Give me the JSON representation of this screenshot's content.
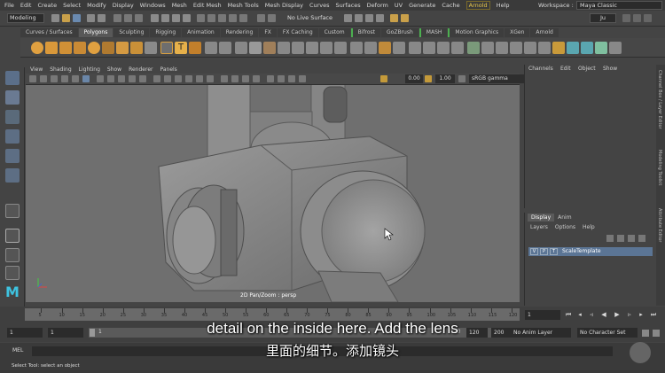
{
  "menubar": {
    "items": [
      "File",
      "Edit",
      "Create",
      "Select",
      "Modify",
      "Display",
      "Windows",
      "Mesh",
      "Edit Mesh",
      "Mesh Tools",
      "Mesh Display",
      "Curves",
      "Surfaces",
      "Deform",
      "UV",
      "Generate",
      "Cache",
      "Arnold",
      "Help"
    ],
    "workspace_label": "Workspace :",
    "workspace_value": "Maya Classic"
  },
  "statusline": {
    "mode": "Modeling",
    "live_surface": "No Live Surface",
    "user": "Ju"
  },
  "shelf_tabs": [
    "Curves / Surfaces",
    "Polygons",
    "Sculpting",
    "Rigging",
    "Animation",
    "Rendering",
    "FX",
    "FX Caching",
    "Custom",
    "Bifrost",
    "GoZBrush",
    "MASH",
    "Motion Graphics",
    "XGen",
    "Arnold"
  ],
  "viewport": {
    "menus": [
      "View",
      "Shading",
      "Lighting",
      "Show",
      "Renderer",
      "Panels"
    ],
    "exposure": "0.00",
    "gamma": "1.00",
    "color_space": "sRGB gamma",
    "camera_label": "2D Pan/Zoom : persp"
  },
  "right_panel": {
    "channel_menus": [
      "Channels",
      "Edit",
      "Object",
      "Show"
    ],
    "layer_tabs": [
      "Display",
      "Anim"
    ],
    "layer_menus": [
      "Layers",
      "Options",
      "Help"
    ],
    "layer": {
      "v": "V",
      "p": "P",
      "t": "T",
      "name": "ScaleTemplate"
    },
    "side_tabs": [
      "Channel Box / Layer Editor",
      "Modeling Toolkit",
      "Attribute Editor"
    ]
  },
  "timeslider": {
    "ticks": [
      "5",
      "10",
      "15",
      "20",
      "25",
      "30",
      "35",
      "40",
      "45",
      "50",
      "55",
      "60",
      "65",
      "70",
      "75",
      "80",
      "85",
      "90",
      "95",
      "100",
      "105",
      "110",
      "115",
      "120"
    ],
    "current_frame": "1"
  },
  "range": {
    "start": "1",
    "start2": "1",
    "handle_label": "1",
    "end_label": "120",
    "end": "120",
    "end2": "200",
    "anim_layer": "No Anim Layer",
    "character_set": "No Character Set"
  },
  "cmdline": {
    "label": "MEL"
  },
  "helpline": {
    "text": "Select Tool: select an object"
  },
  "subtitles": {
    "en": "detail on the inside here. Add the lens",
    "zh": "里面的细节。添加镜头"
  },
  "colors": {
    "accent": "#5b7595",
    "arnold": "#e8c74a",
    "shelf_icon": "#e0a040"
  }
}
